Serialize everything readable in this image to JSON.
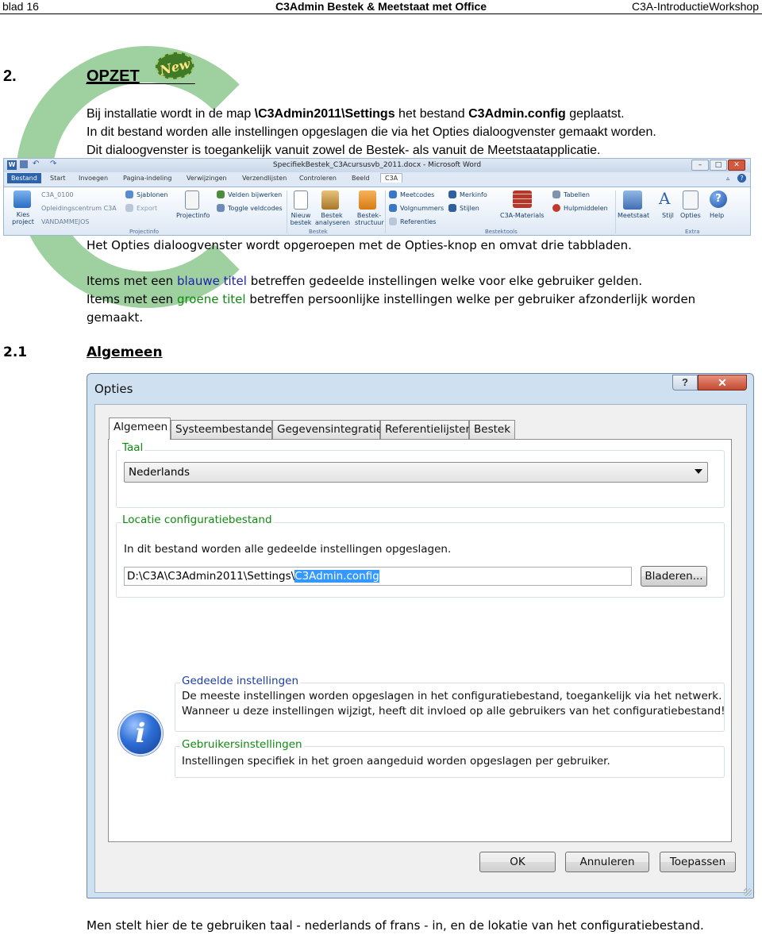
{
  "header": {
    "page": "blad 16",
    "title": "C3Admin Bestek & Meetstaat met Office",
    "right": "C3A-IntroductieWorkshop"
  },
  "section2": {
    "number": "2.",
    "title": "OPZET",
    "badge": "New"
  },
  "intro": {
    "line1_a": "Bij installatie wordt in de map ",
    "line1_b": "\\C3Admin2011\\Settings",
    "line1_c": " het bestand ",
    "line1_d": "C3Admin.config",
    "line1_e": " geplaatst.",
    "line2": "In dit bestand worden alle instellingen opgeslagen die via het Opties dialoogvenster gemaakt worden.",
    "line3": "Dit dialoogvenster is toegankelijk vanuit zowel de Bestek- als vanuit de Meetstaatapplicatie."
  },
  "ribbon": {
    "doc_title": "SpecifiekBestek_C3Acursusvb_2011.docx - Microsoft Word",
    "tabs": [
      "Bestand",
      "Start",
      "Invoegen",
      "Pagina-indeling",
      "Verwijzingen",
      "Verzendlijsten",
      "Controleren",
      "Beeld",
      "C3A"
    ],
    "kies_project": "Kies project",
    "project_lines": [
      "C3A_0100",
      "Opleidingscentrum C3A",
      "VANDAMMEJOS"
    ],
    "sjablonen": "Sjablonen",
    "export": "Export",
    "projectinfo": "Projectinfo",
    "velden": "Velden bijwerken",
    "toggle": "Toggle veldcodes",
    "nieuw": "Nieuw bestek",
    "analyseren": "Bestek analyseren",
    "structuur": "Bestek-structuur",
    "meetcodes": "Meetcodes",
    "volgnummers": "Volgnummers",
    "referenties": "Referenties",
    "merkinfo": "Merkinfo",
    "stijlen": "Stijlen",
    "materials": "C3A-Materials",
    "tabellen": "Tabellen",
    "hulpmiddelen": "Hulpmiddelen",
    "meetstaat": "Meetstaat",
    "stijl": "Stijl",
    "opties": "Opties",
    "help": "Help",
    "groups": [
      "Projectinfo",
      "Bestek",
      "Bestektools",
      "Extra"
    ]
  },
  "para1": "Het Opties dialoogvenster wordt opgeroepen met de Opties-knop en omvat drie tabbladen.",
  "para2": {
    "a": "Items met een ",
    "b": "blauwe titel",
    "c": " betreffen gedeelde instellingen welke voor elke gebruiker gelden."
  },
  "para3": {
    "a": "Items met een ",
    "b": "groene titel",
    "c": " betreffen persoonlijke instellingen welke per gebruiker afzonderlijk worden",
    "d": "gemaakt."
  },
  "section21": {
    "number": "2.1",
    "title": "Algemeen"
  },
  "dialog": {
    "title": "Opties",
    "help": "?",
    "close": "✕",
    "tabs": [
      "Algemeen",
      "Systeembestanden",
      "Gegevensintegratie",
      "Referentielijsten",
      "Bestek"
    ],
    "taal_label": "Taal",
    "taal_value": "Nederlands",
    "locatie_label": "Locatie configuratiebestand",
    "locatie_desc": "In dit bestand worden alle gedeelde instellingen opgeslagen.",
    "path_prefix": "D:\\C3A\\C3Admin2011\\Settings\\",
    "path_selected": "C3Admin.config",
    "browse": "Bladeren...",
    "gedeelde_title": "Gedeelde instellingen",
    "gedeelde_line1": "De meeste instellingen worden opgeslagen in het configuratiebestand, toegankelijk via het netwerk.",
    "gedeelde_line2": "Wanneer u deze instellingen wijzigt, heeft dit invloed op alle gebruikers van het configuratiebestand!",
    "gebruikers_title": "Gebruikersinstellingen",
    "gebruikers_line1": "Instellingen specifiek in het groen aangeduid worden opgeslagen per gebruiker.",
    "ok": "OK",
    "cancel": "Annuleren",
    "apply": "Toepassen",
    "colors": {
      "green_title": "#0f8a0f",
      "blue_title": "#1c3ea3"
    }
  },
  "footer_para": "Men stelt hier de te gebruiken taal - nederlands of frans - in, en de lokatie van het configuratiebestand."
}
